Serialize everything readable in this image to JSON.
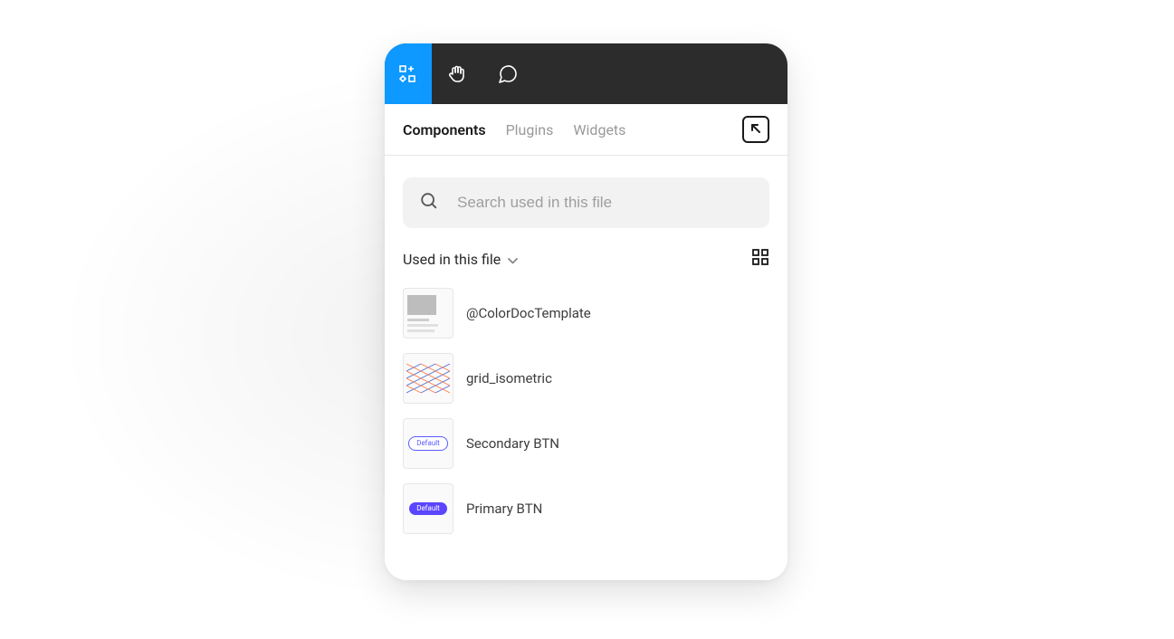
{
  "tabs": {
    "components": "Components",
    "plugins": "Plugins",
    "widgets": "Widgets"
  },
  "search": {
    "placeholder": "Search used in this file"
  },
  "filter": {
    "label": "Used in this file"
  },
  "components": [
    {
      "name": "@ColorDocTemplate"
    },
    {
      "name": "grid_isometric"
    },
    {
      "name": "Secondary BTN"
    },
    {
      "name": "Primary BTN"
    }
  ],
  "thumbs": {
    "pill_label": "Default"
  }
}
